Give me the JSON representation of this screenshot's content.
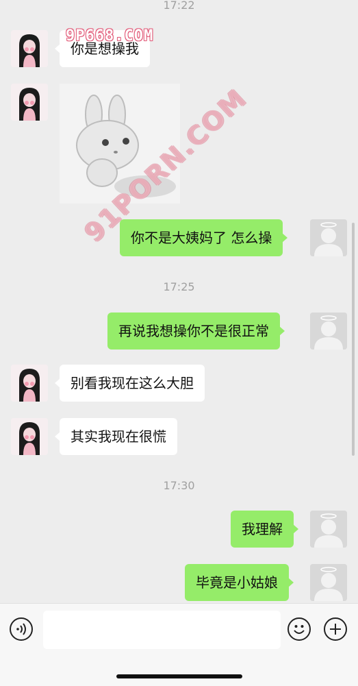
{
  "watermarks": [
    "9P668.COM",
    "91PORN.COM"
  ],
  "timestamps": [
    "17:22",
    "17:25",
    "17:30"
  ],
  "messages": [
    {
      "side": "left",
      "type": "text",
      "text": "你是想操我"
    },
    {
      "side": "left",
      "type": "sticker",
      "sticker": "bunny-sticker"
    },
    {
      "side": "right",
      "type": "text",
      "text": "你不是大姨妈了 怎么操"
    },
    {
      "side": "right",
      "type": "text",
      "text": "再说我想操你不是很正常"
    },
    {
      "side": "left",
      "type": "text",
      "text": "别看我现在这么大胆"
    },
    {
      "side": "left",
      "type": "text",
      "text": "其实我现在很慌"
    },
    {
      "side": "right",
      "type": "text",
      "text": "我理解"
    },
    {
      "side": "right",
      "type": "text",
      "text": "毕竟是小姑娘"
    }
  ],
  "input_bar": {
    "voice_icon": "voice-icon",
    "emoji_icon": "emoji-icon",
    "plus_icon": "plus-icon",
    "input_value": ""
  },
  "colors": {
    "background": "#ededed",
    "bubble_self": "#95ec69",
    "bubble_other": "#ffffff"
  }
}
